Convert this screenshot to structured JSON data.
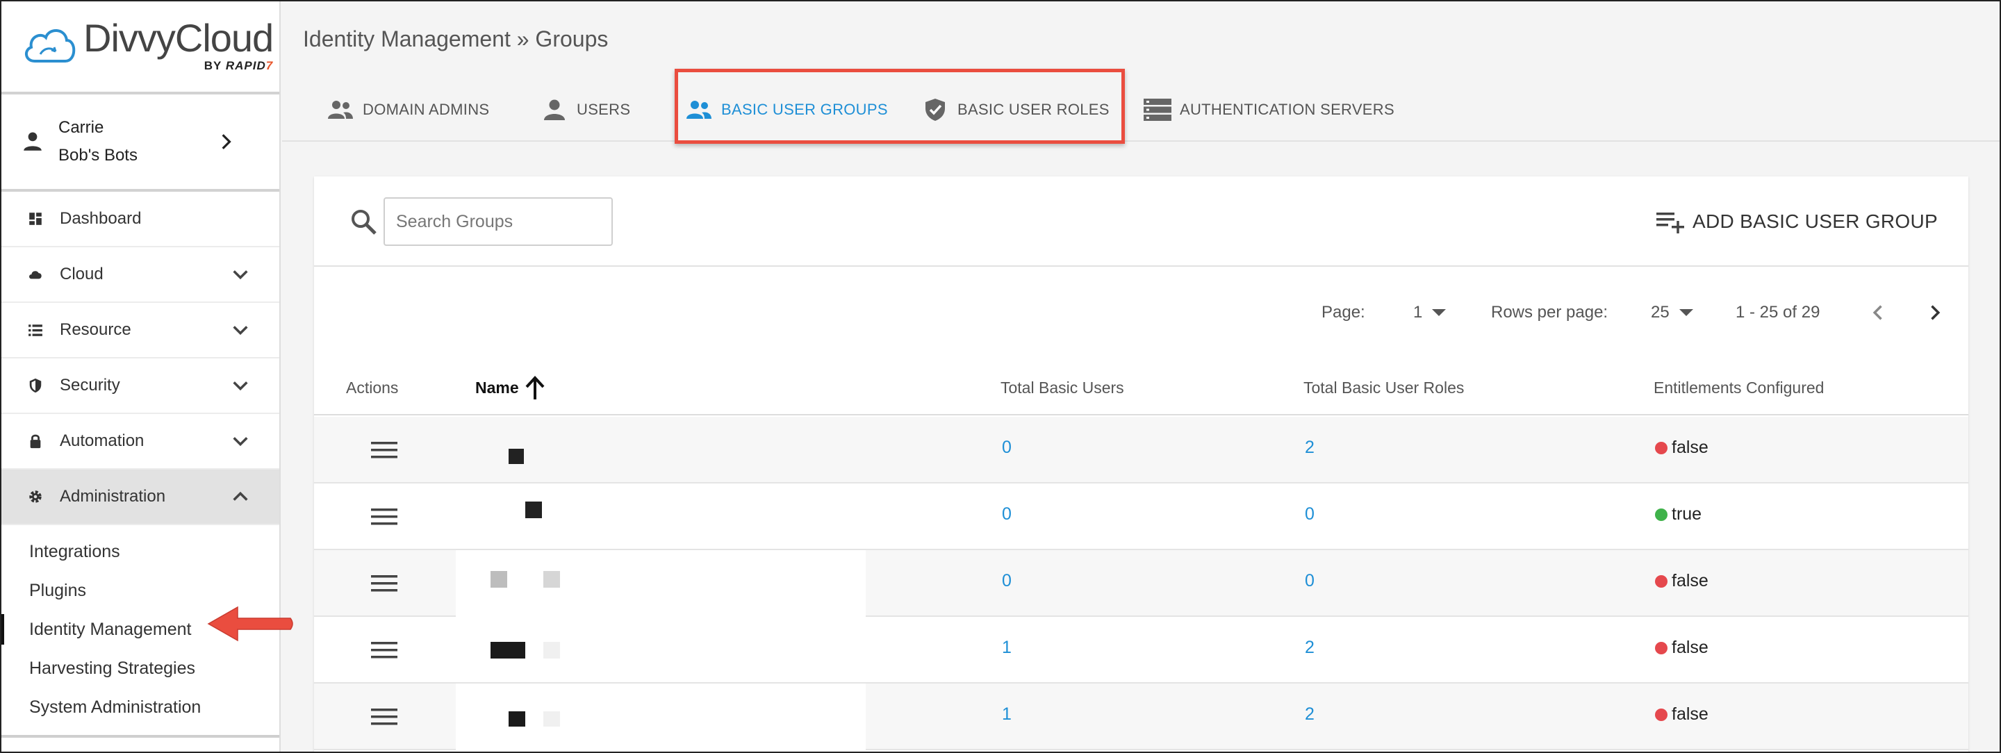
{
  "brand": {
    "name": "DivvyCloud",
    "by": "BY",
    "rapid": "RAPID",
    "rapid_mark": "7"
  },
  "account": {
    "user": "Carrie",
    "org": "Bob's Bots"
  },
  "nav": {
    "items": [
      {
        "label": "Dashboard",
        "icon": "dashboard-icon"
      },
      {
        "label": "Cloud",
        "icon": "cloud-icon"
      },
      {
        "label": "Resource",
        "icon": "list-icon"
      },
      {
        "label": "Security",
        "icon": "shield-icon"
      },
      {
        "label": "Automation",
        "icon": "lock-icon"
      },
      {
        "label": "Administration",
        "icon": "gear-icon"
      }
    ],
    "sub": [
      {
        "label": "Integrations"
      },
      {
        "label": "Plugins"
      },
      {
        "label": "Identity Management"
      },
      {
        "label": "Harvesting Strategies"
      },
      {
        "label": "System Administration"
      }
    ]
  },
  "breadcrumb": "Identity Management » Groups",
  "tabs": [
    {
      "label": "DOMAIN ADMINS",
      "icon": "people-icon"
    },
    {
      "label": "USERS",
      "icon": "person-icon"
    },
    {
      "label": "BASIC USER GROUPS",
      "icon": "people-icon",
      "active": true
    },
    {
      "label": "BASIC USER ROLES",
      "icon": "shield-check-icon"
    },
    {
      "label": "AUTHENTICATION SERVERS",
      "icon": "server-icon"
    }
  ],
  "toolbar": {
    "search_placeholder": "Search Groups",
    "add_label": "ADD BASIC USER GROUP"
  },
  "pager": {
    "page_label": "Page:",
    "page": "1",
    "rows_label": "Rows per page:",
    "rows": "25",
    "range": "1 - 25 of 29"
  },
  "table": {
    "headers": [
      "Actions",
      "Name",
      "Total Basic Users",
      "Total Basic User Roles",
      "Entitlements Configured"
    ],
    "rows": [
      {
        "users": "0",
        "roles": "2",
        "entitlements": "false"
      },
      {
        "users": "0",
        "roles": "0",
        "entitlements": "true"
      },
      {
        "users": "0",
        "roles": "0",
        "entitlements": "false"
      },
      {
        "users": "1",
        "roles": "2",
        "entitlements": "false"
      },
      {
        "users": "1",
        "roles": "2",
        "entitlements": "false"
      }
    ]
  },
  "colors": {
    "accent": "#1e8fd6",
    "true_dot": "#3fb24a",
    "false_dot": "#e5484d",
    "highlight": "#ea4d3f"
  }
}
